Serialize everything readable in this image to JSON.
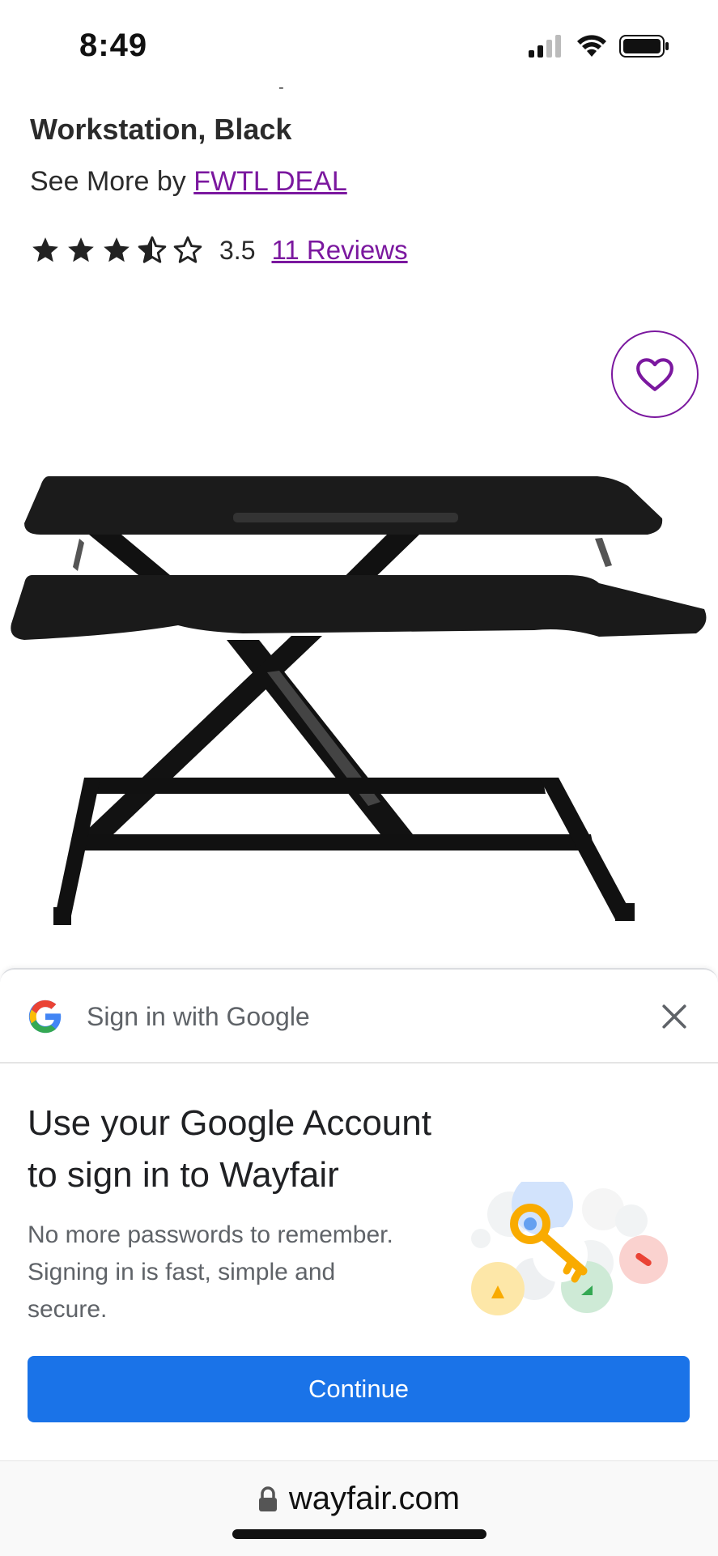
{
  "status_bar": {
    "time": "8:49"
  },
  "product": {
    "title_line1": "Converter Tabletop, Dual Monitor Riser",
    "title_line2": "Workstation, Black",
    "see_more_prefix": "See More by",
    "brand": "FWTL DEAL",
    "rating": "3.5",
    "rating_stars": 3.5,
    "reviews_label": "11 Reviews"
  },
  "google_signin": {
    "header_title": "Sign in with Google",
    "heading_line1": "Use your Google Account",
    "heading_line2": "to sign in to Wayfair",
    "desc_line1": "No more passwords to remember.",
    "desc_line2": "Signing in is fast, simple and",
    "desc_line3": "secure.",
    "continue_label": "Continue",
    "button_color": "#1a73e8"
  },
  "browser": {
    "url": "wayfair.com"
  },
  "colors": {
    "accent": "#7b189f"
  },
  "icons": [
    "signal-icon",
    "wifi-icon",
    "battery-icon",
    "star-icon",
    "heart-icon",
    "google-logo-icon",
    "close-icon",
    "key-illustration-icon",
    "lock-icon"
  ]
}
